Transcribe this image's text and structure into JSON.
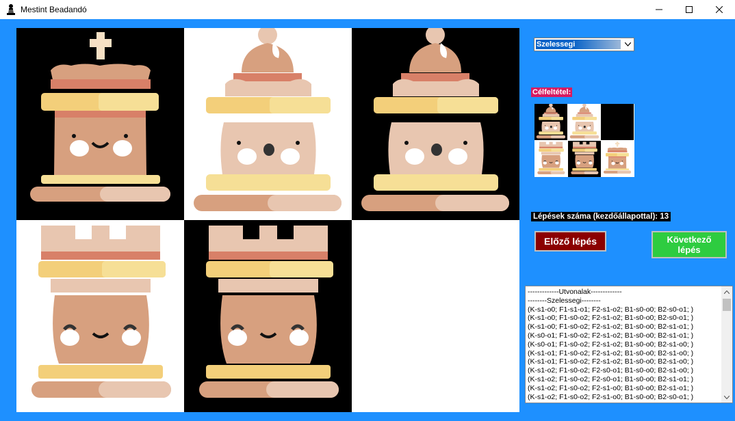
{
  "window": {
    "title": "Mestint Beadandó",
    "app_icon": "chess-pawn-icon",
    "controls": [
      "minimize-icon",
      "maximize-icon",
      "close-icon"
    ]
  },
  "colors": {
    "background": "#1e90ff",
    "dark_square": "#000000",
    "light_square": "#ffffff",
    "goal_label_bg": "#d81b60",
    "prev_button_bg": "#8b0000",
    "next_button_bg": "#2ecc40"
  },
  "board": {
    "rows": 2,
    "cols": 3,
    "cells": [
      {
        "piece": "king",
        "square": "dark"
      },
      {
        "piece": "bishop",
        "square": "light"
      },
      {
        "piece": "bishop",
        "square": "dark"
      },
      {
        "piece": "rook",
        "square": "light"
      },
      {
        "piece": "rook",
        "square": "dark"
      },
      {
        "piece": "empty",
        "square": "light"
      }
    ]
  },
  "search": {
    "selected": "Szelessegi"
  },
  "goal": {
    "label": "Célfeltétel:",
    "cells": [
      {
        "piece": "bishop",
        "square": "dark"
      },
      {
        "piece": "bishop",
        "square": "light"
      },
      {
        "piece": "empty",
        "square": "dark"
      },
      {
        "piece": "rook",
        "square": "light"
      },
      {
        "piece": "rook",
        "square": "dark"
      },
      {
        "piece": "king",
        "square": "light"
      }
    ]
  },
  "steps": {
    "label": "Lépések száma (kezdőállapottal): 13"
  },
  "buttons": {
    "prev": "Előző lépés",
    "next": "Következő lépés"
  },
  "routes": {
    "lines": [
      "-------------Utvonalak-------------",
      "--------Szelessegi--------",
      "(K-s1-o0; F1-s1-o1; F2-s1-o2; B1-s0-o0; B2-s0-o1; )",
      "(K-s1-o0; F1-s0-o2; F2-s1-o2; B1-s0-o0; B2-s0-o1; )",
      "(K-s1-o0; F1-s0-o2; F2-s1-o2; B1-s0-o0; B2-s1-o1; )",
      "(K-s0-o1; F1-s0-o2; F2-s1-o2; B1-s0-o0; B2-s1-o1; )",
      "(K-s0-o1; F1-s0-o2; F2-s1-o2; B1-s0-o0; B2-s1-o0; )",
      "(K-s1-o1; F1-s0-o2; F2-s1-o2; B1-s0-o0; B2-s1-o0; )",
      "(K-s1-o1; F1-s0-o2; F2-s1-o2; B1-s0-o0; B2-s1-o0; )",
      "(K-s1-o2; F1-s0-o2; F2-s0-o1; B1-s0-o0; B2-s1-o0; )",
      "(K-s1-o2; F1-s0-o2; F2-s0-o1; B1-s0-o0; B2-s1-o1; )",
      "(K-s1-o2; F1-s0-o2; F2-s1-o0; B1-s0-o0; B2-s1-o1; )",
      "(K-s1-o2; F1-s0-o2; F2-s1-o0; B1-s0-o0; B2-s0-o1; )"
    ]
  }
}
